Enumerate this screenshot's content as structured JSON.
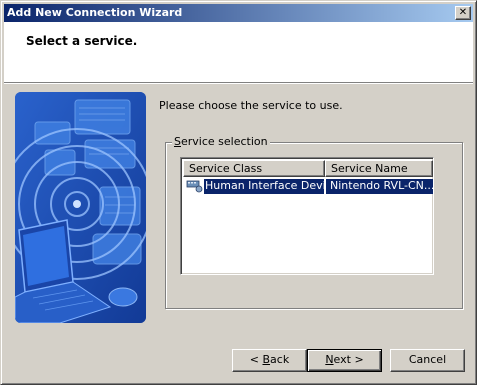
{
  "window": {
    "title": "Add New Connection Wizard"
  },
  "header": {
    "title": "Select a service."
  },
  "instruction": "Please choose the service to use.",
  "group": {
    "label_accel": "S",
    "label_rest": "ervice selection"
  },
  "list": {
    "columns": [
      "Service Class",
      "Service Name"
    ],
    "rows": [
      {
        "icon": "hid-device-icon",
        "service_class": "Human Interface Device",
        "service_name": "Nintendo RVL-CN...",
        "selected": true
      }
    ]
  },
  "buttons": {
    "back_prefix": "< ",
    "back_accel": "B",
    "back_rest": "ack",
    "next_accel": "N",
    "next_rest": "ext >",
    "cancel": "Cancel"
  },
  "colors": {
    "titlebar": "#0a246a",
    "selection": "#0a246a",
    "face": "#d4d0c8"
  }
}
